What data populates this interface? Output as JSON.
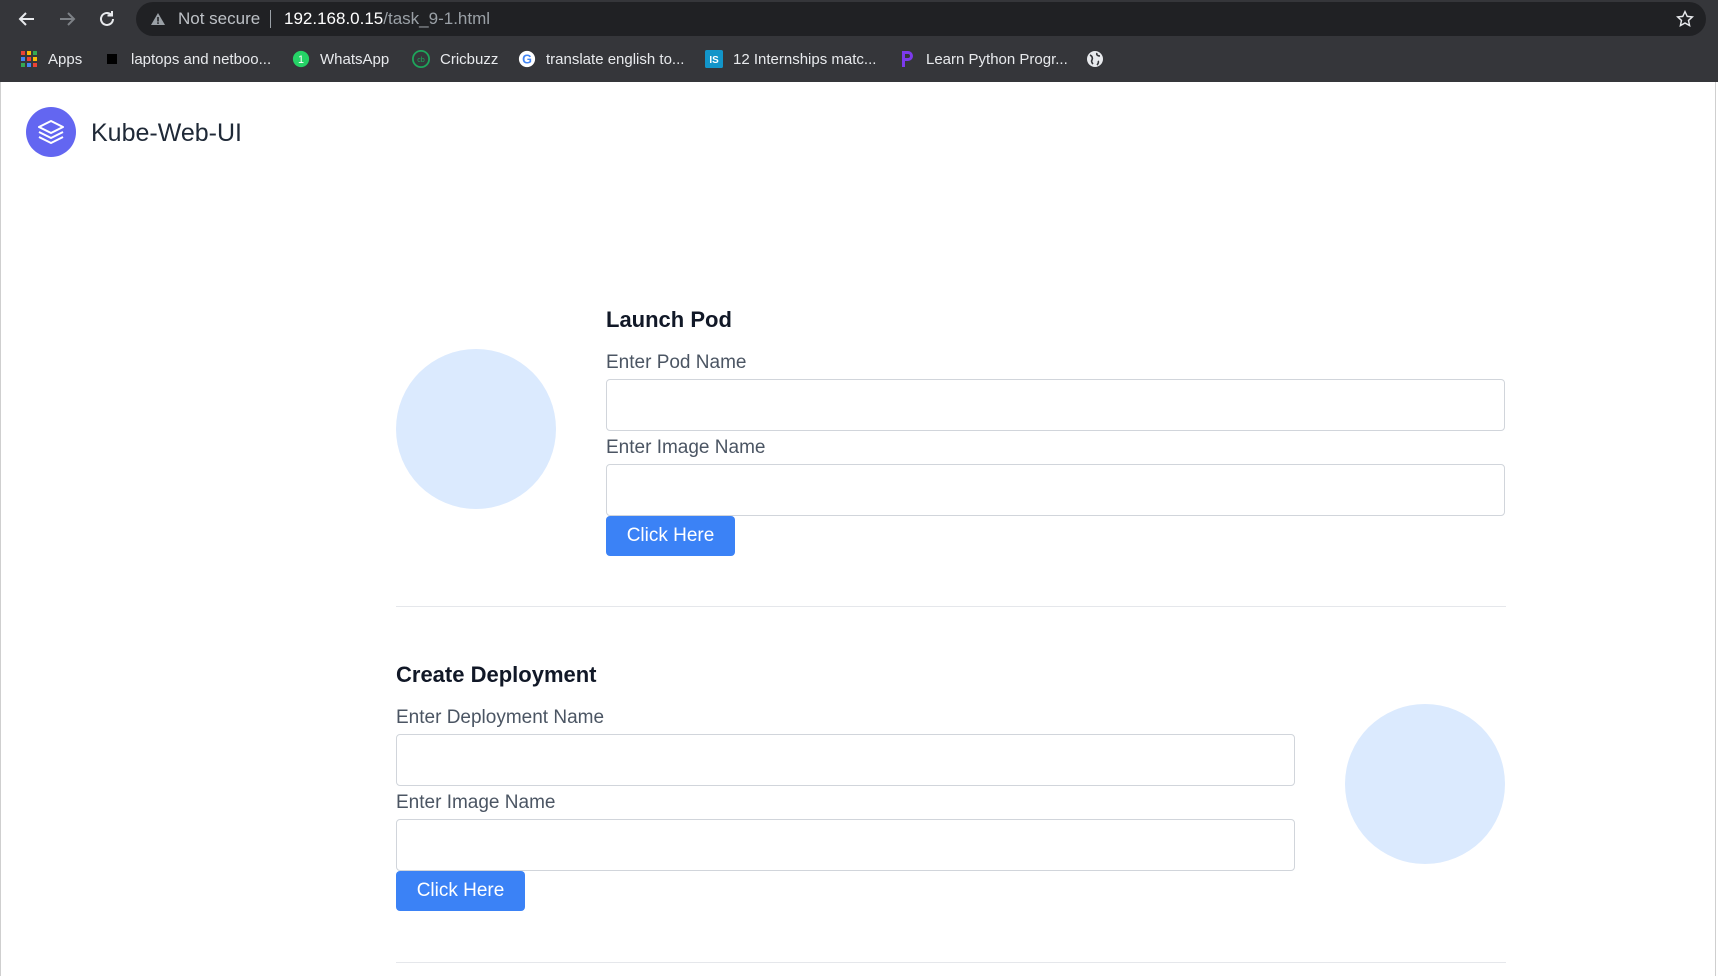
{
  "browser": {
    "security_label": "Not secure",
    "url_host": "192.168.0.15",
    "url_path": "/task_9-1.html",
    "bookmarks": [
      {
        "label": "Apps",
        "icon": "apps-grid-icon"
      },
      {
        "label": "laptops and netboo...",
        "icon": "black-square-icon"
      },
      {
        "label": "WhatsApp",
        "icon": "whatsapp-icon"
      },
      {
        "label": "Cricbuzz",
        "icon": "cricbuzz-icon"
      },
      {
        "label": "translate english to...",
        "icon": "google-icon"
      },
      {
        "label": "12 Internships matc...",
        "icon": "internshala-icon"
      },
      {
        "label": "Learn Python Progr...",
        "icon": "python-course-icon"
      },
      {
        "label": "",
        "icon": "globe-icon"
      }
    ]
  },
  "header": {
    "brand": "Kube-Web-UI",
    "logo_icon": "layers-icon"
  },
  "launch_pod": {
    "title": "Launch Pod",
    "pod_name_label": "Enter Pod Name",
    "pod_name_value": "",
    "image_label": "Enter Image Name",
    "image_value": "",
    "button_label": "Click Here"
  },
  "create_deployment": {
    "title": "Create Deployment",
    "deployment_name_label": "Enter Deployment Name",
    "deployment_name_value": "",
    "image_label": "Enter Image Name",
    "image_value": "",
    "button_label": "Click Here"
  },
  "colors": {
    "accent_button": "#3b82f6",
    "brand_logo": "#6366f1",
    "decor_circle": "#dbeafe",
    "chrome_bg": "#35363a"
  }
}
